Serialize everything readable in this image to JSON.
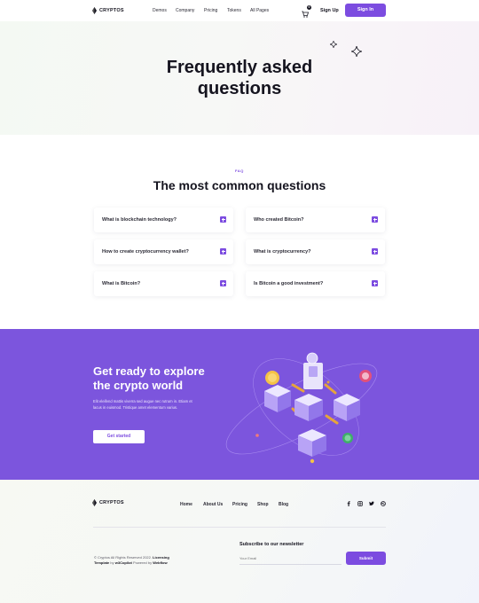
{
  "header": {
    "brand": "CRYPTOS",
    "nav": [
      "Demos",
      "Company",
      "Pricing",
      "Tokens",
      "All Pages"
    ],
    "cart_count": "0",
    "signup_label": "Sign Up",
    "signin_label": "Sign In"
  },
  "hero": {
    "title_line1": "Frequently asked",
    "title_line2": "questions"
  },
  "faq": {
    "eyebrow": "FAQ",
    "title": "The most common questions",
    "items": [
      "What is blockchain technology?",
      "Who created Bitcoin?",
      "How to create cryptocurrency wallet?",
      "What is cryptocurrency?",
      "What is Bitcoin?",
      "Is Bitcoin a good investment?"
    ]
  },
  "cta": {
    "title_line1": "Get ready to explore",
    "title_line2": "the crypto world",
    "text": "Elit eleifend mattis viverra sed augue nec rutrum in. Etiam et lacus in euismod. Tristique amet elementum varius.",
    "button_label": "Get started"
  },
  "footer": {
    "brand": "CRYPTOS",
    "nav": [
      "Home",
      "About Us",
      "Pricing",
      "Shop",
      "Blog"
    ],
    "social": [
      "facebook-icon",
      "instagram-icon",
      "twitter-icon",
      "dribbble-icon"
    ],
    "copyright": "© Cryptos All Rights Reserved 2022.",
    "licensing": "Licensing",
    "template_by": "Template",
    "by": "by",
    "author": "w3Copilot",
    "powered": "Powered by",
    "platform": "Webflow",
    "newsletter_title": "Subscribe to our newsletter",
    "email_placeholder": "Your Email",
    "submit_label": "Submit"
  },
  "colors": {
    "accent": "#7c4ce0",
    "cta_background": "#7c55dd"
  }
}
